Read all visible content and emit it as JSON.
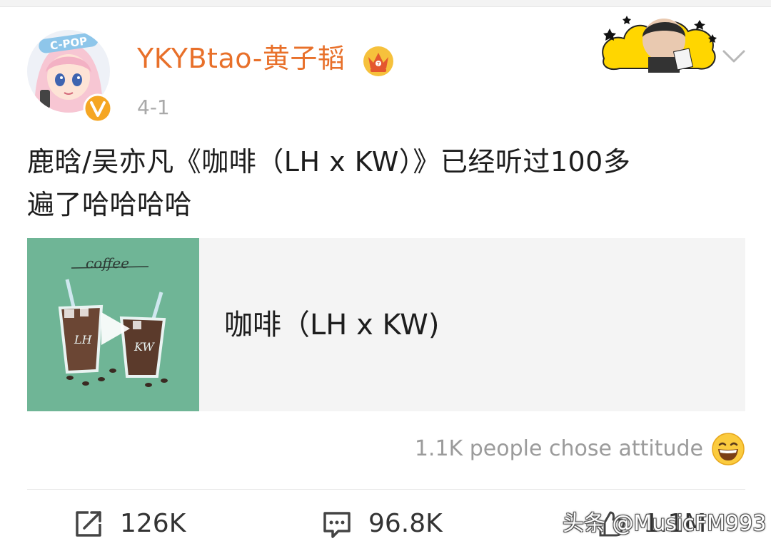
{
  "post": {
    "username": "YKYBtao-黄子韬",
    "date": "4-1",
    "text_line1": "鹿晗/吴亦凡《咖啡（LH x KW）》已经听过100多",
    "text_line2": "遍了哈哈哈哈"
  },
  "avatar_badge_text": "C-POP",
  "music_card": {
    "title": "咖啡（LH x KW)",
    "cover_text": "coffee",
    "cup_left_text": "LH",
    "cup_right_text": "KW"
  },
  "attitude": {
    "text": "1.1K people chose attitude"
  },
  "actions": {
    "repost_count": "126K",
    "comment_count": "96.8K",
    "like_count": "1.1M"
  },
  "watermark": "头条 @MusicFM993",
  "colors": {
    "username": "#e8702a",
    "verified": "#f5a623",
    "card_bg": "#f4f4f4",
    "cover_bg": "#6fb596"
  },
  "icons": {
    "repost": "share-box-icon",
    "comment": "comment-bubble-icon",
    "like": "thumb-up-icon",
    "chevron": "chevron-down-icon"
  }
}
